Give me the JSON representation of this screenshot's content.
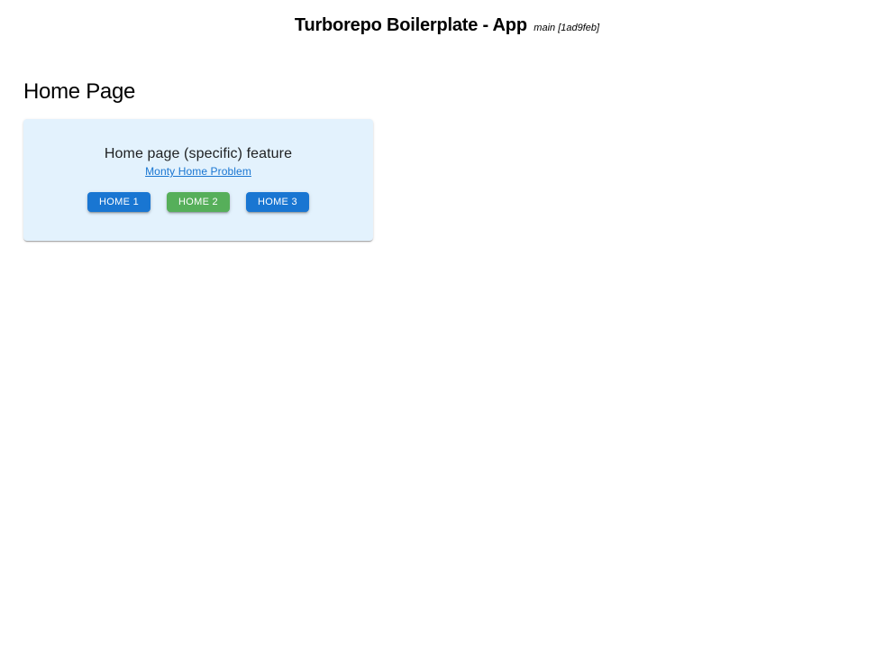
{
  "header": {
    "title": "Turborepo Boilerplate - App",
    "meta": "main [1ad9feb]"
  },
  "page": {
    "title": "Home Page"
  },
  "card": {
    "title": "Home page (specific) feature",
    "link_text": "Monty Home Problem",
    "buttons": [
      {
        "label": "HOME 1",
        "variant": "primary"
      },
      {
        "label": "HOME 2",
        "variant": "success"
      },
      {
        "label": "HOME 3",
        "variant": "primary"
      }
    ]
  }
}
